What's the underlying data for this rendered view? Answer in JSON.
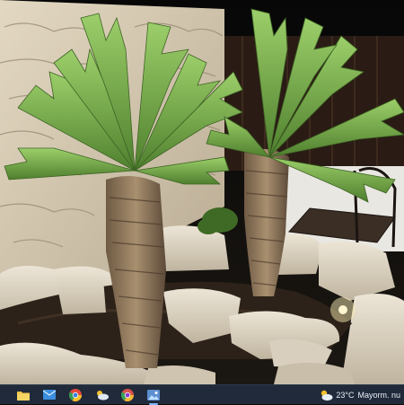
{
  "taskbar": {
    "apps": [
      {
        "name": "file-explorer-icon",
        "color": "#f4c54a"
      },
      {
        "name": "mail-icon",
        "color": "#3b8ee0"
      },
      {
        "name": "chrome-icon",
        "color": "#e2483a"
      },
      {
        "name": "weather-app-icon",
        "color": "#6ea8e8"
      },
      {
        "name": "chrome-profile-icon",
        "color": "#d8524a"
      },
      {
        "name": "photos-icon",
        "color": "#5d8fd0"
      }
    ],
    "weather": {
      "temperature": "23°C",
      "condition": "Mayorm. nu"
    }
  }
}
